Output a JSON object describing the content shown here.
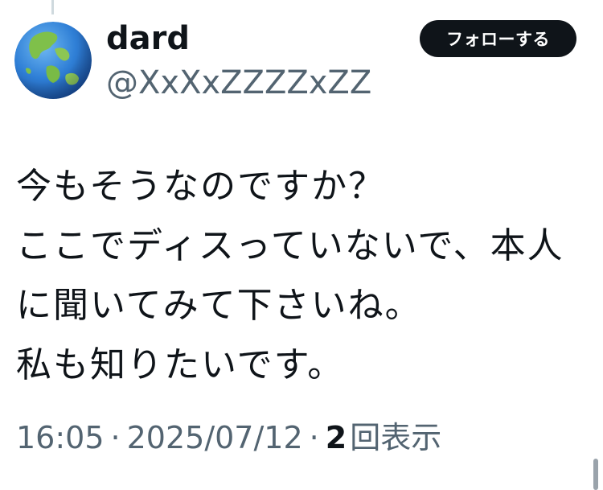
{
  "author": {
    "display_name": "dard",
    "handle": "@XxXxZZZZxZZ",
    "avatar_icon": "earth-globe-icon"
  },
  "follow_button": {
    "label": "フォローする"
  },
  "tweet": {
    "lines": [
      "今もそうなのですか？",
      "ここでディスっていないで、本人",
      "に聞いてみて下さいね。",
      "私も知りたいです。"
    ]
  },
  "meta": {
    "time": "16:05",
    "separator": "·",
    "date": "2025/07/12",
    "views_count": "2",
    "views_label": "回表示"
  },
  "colors": {
    "text_primary": "#0f1419",
    "text_secondary": "#536471",
    "button_bg": "#0f1419",
    "button_text": "#ffffff"
  }
}
